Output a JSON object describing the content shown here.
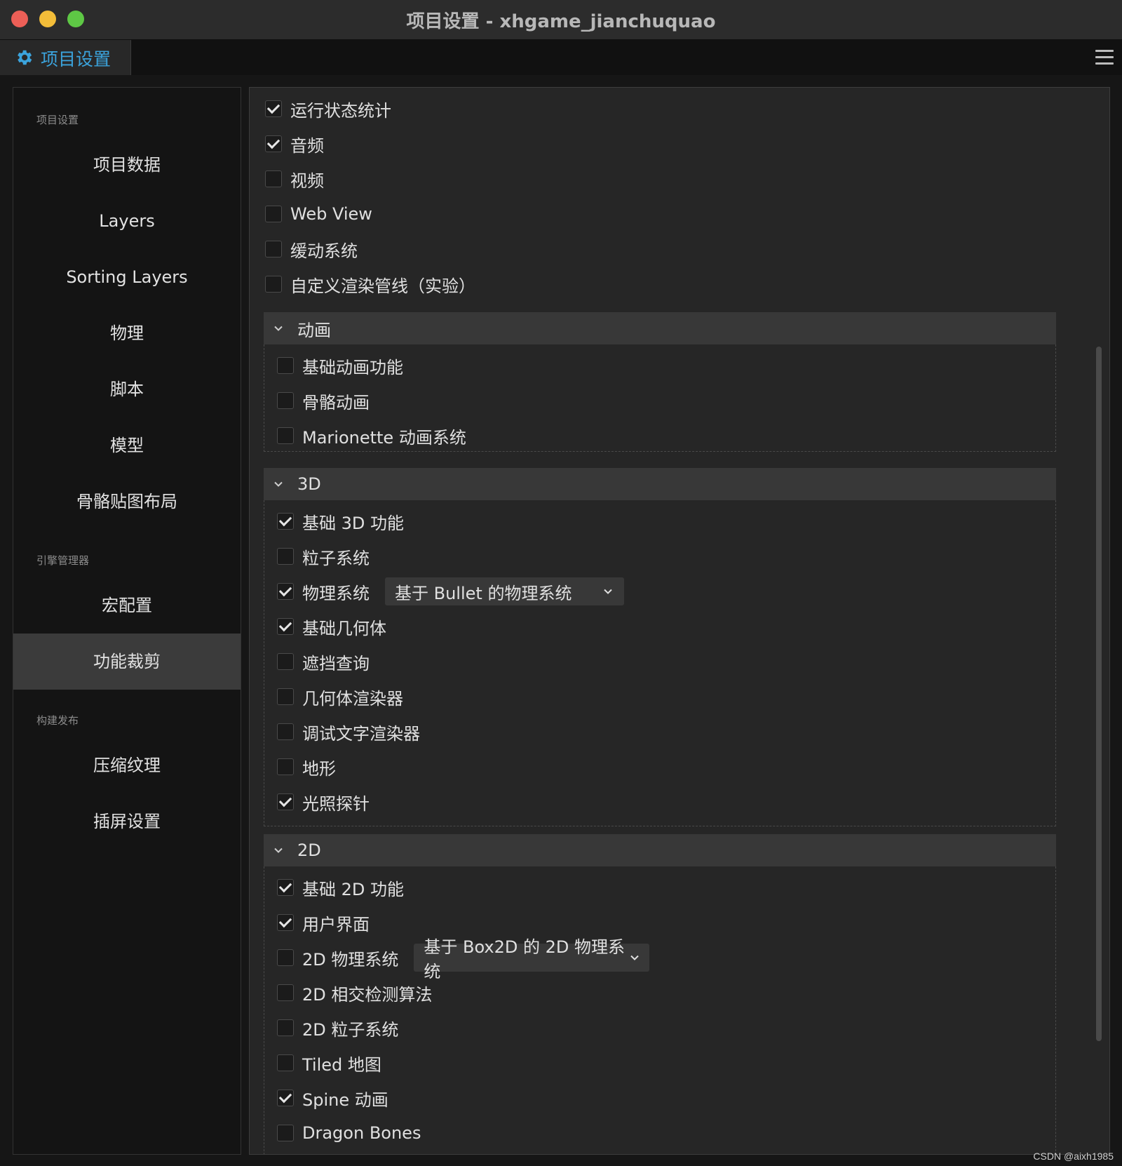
{
  "window": {
    "title": "项目设置 - xhgame_jianchuquao"
  },
  "tab": {
    "label": "项目设置",
    "icon": "gear-icon",
    "accent": "#3ba3dc"
  },
  "sidebar": {
    "sections": [
      {
        "title": "项目设置",
        "items": [
          "项目数据",
          "Layers",
          "Sorting Layers",
          "物理",
          "脚本",
          "模型",
          "骨骼贴图布局"
        ]
      },
      {
        "title": "引擎管理器",
        "items": [
          "宏配置",
          "功能裁剪"
        ]
      },
      {
        "title": "构建发布",
        "items": [
          "压缩纹理",
          "插屏设置"
        ]
      }
    ],
    "active": "功能裁剪"
  },
  "features": {
    "top": [
      {
        "label": "运行状态统计",
        "checked": true
      },
      {
        "label": "音频",
        "checked": true
      },
      {
        "label": "视频",
        "checked": false
      },
      {
        "label": "Web View",
        "checked": false
      },
      {
        "label": "缓动系统",
        "checked": false
      },
      {
        "label": "自定义渲染管线（实验）",
        "checked": false
      }
    ],
    "groups": [
      {
        "title": "动画",
        "items": [
          {
            "label": "基础动画功能",
            "checked": false
          },
          {
            "label": "骨骼动画",
            "checked": false
          },
          {
            "label": "Marionette 动画系统",
            "checked": false
          }
        ]
      },
      {
        "title": "3D",
        "items": [
          {
            "label": "基础 3D 功能",
            "checked": true
          },
          {
            "label": "粒子系统",
            "checked": false
          },
          {
            "label": "物理系统",
            "checked": true,
            "select": "基于 Bullet 的物理系统"
          },
          {
            "label": "基础几何体",
            "checked": true
          },
          {
            "label": "遮挡查询",
            "checked": false
          },
          {
            "label": "几何体渲染器",
            "checked": false
          },
          {
            "label": "调试文字渲染器",
            "checked": false
          },
          {
            "label": "地形",
            "checked": false
          },
          {
            "label": "光照探针",
            "checked": true
          }
        ]
      },
      {
        "title": "2D",
        "items": [
          {
            "label": "基础 2D 功能",
            "checked": true
          },
          {
            "label": "用户界面",
            "checked": true
          },
          {
            "label": "2D 物理系统",
            "checked": false,
            "select": "基于 Box2D 的 2D 物理系统"
          },
          {
            "label": "2D 相交检测算法",
            "checked": false
          },
          {
            "label": "2D 粒子系统",
            "checked": false
          },
          {
            "label": "Tiled 地图",
            "checked": false
          },
          {
            "label": "Spine 动画",
            "checked": true
          },
          {
            "label": "Dragon Bones",
            "checked": false
          }
        ]
      }
    ]
  },
  "watermark": "CSDN @aixh1985"
}
